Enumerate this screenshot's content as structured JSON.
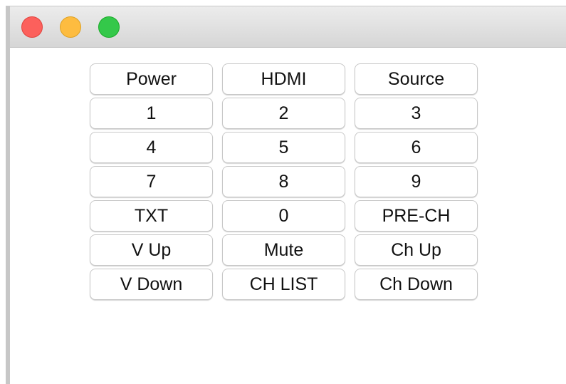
{
  "window": {
    "controls": {
      "close": "close-control",
      "minimize": "minimize-control",
      "zoom": "zoom-control"
    }
  },
  "keypad": {
    "rows": [
      [
        "Power",
        "HDMI",
        "Source"
      ],
      [
        "1",
        "2",
        "3"
      ],
      [
        "4",
        "5",
        "6"
      ],
      [
        "7",
        "8",
        "9"
      ],
      [
        "TXT",
        "0",
        "PRE-CH"
      ],
      [
        "V Up",
        "Mute",
        "Ch Up"
      ],
      [
        "V Down",
        "CH LIST",
        "Ch Down"
      ]
    ]
  }
}
